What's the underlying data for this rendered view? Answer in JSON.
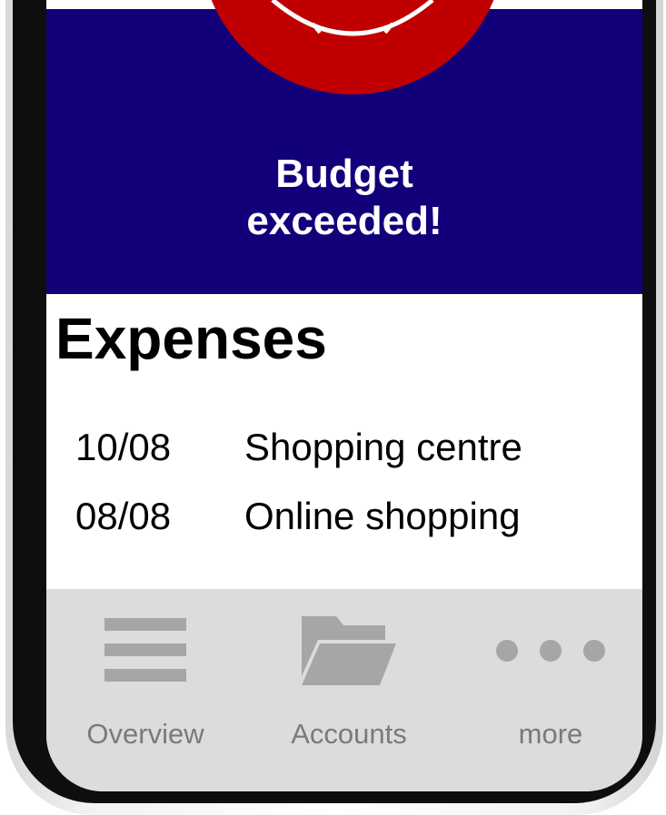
{
  "alert": {
    "line1": "Budget",
    "line2": "exceeded!",
    "icon": "alert-icon",
    "background_color": "#12007a",
    "circle_color": "#c00000"
  },
  "expenses": {
    "title": "Expenses",
    "items": [
      {
        "date": "10/08",
        "description": "Shopping centre"
      },
      {
        "date": "08/08",
        "description": "Online shopping"
      }
    ]
  },
  "nav": {
    "items": [
      {
        "label": "Overview",
        "icon": "menu-icon"
      },
      {
        "label": "Accounts",
        "icon": "folder-icon"
      },
      {
        "label": "more",
        "icon": "more-dots-icon"
      }
    ],
    "icon_color": "#a6a6a6",
    "background_color": "#dcdcdc"
  }
}
